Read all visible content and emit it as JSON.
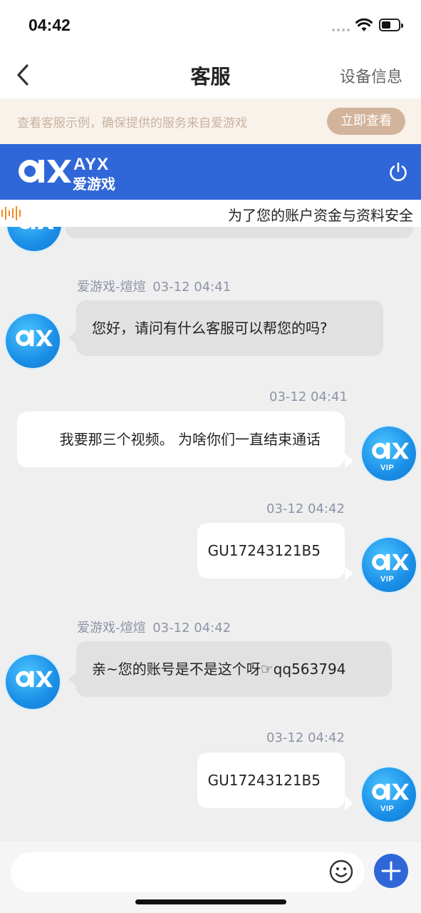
{
  "status_bar": {
    "time": "04:42"
  },
  "nav": {
    "title": "客服",
    "right_label": "设备信息"
  },
  "notice": {
    "text": "查看客服示例，确保提供的服务来自爱游戏",
    "button_label": "立即查看"
  },
  "brand": {
    "name_en": "AYX",
    "name_cn": "爱游戏",
    "color": "#2f67d8"
  },
  "marquee": {
    "text": "为了您的账户资金与资料安全"
  },
  "messages": [
    {
      "side": "left",
      "sender": "爱游戏-煊煊",
      "time": "03-12 04:41",
      "text": "您好，请问有什么客服可以帮您的吗?"
    },
    {
      "side": "right",
      "time": "03-12 04:41",
      "text": "我要那三个视频。 为啥你们一直结束通话"
    },
    {
      "side": "right",
      "time": "03-12 04:42",
      "text": "GU17243121B5"
    },
    {
      "side": "left",
      "sender": "爱游戏-煊煊",
      "time": "03-12 04:42",
      "text": "亲~您的账号是不是这个呀☞qq563794"
    },
    {
      "side": "right",
      "time": "03-12 04:42",
      "text": "GU17243121B5"
    }
  ],
  "avatar": {
    "vip_label": "VIP"
  },
  "input": {
    "placeholder": ""
  }
}
